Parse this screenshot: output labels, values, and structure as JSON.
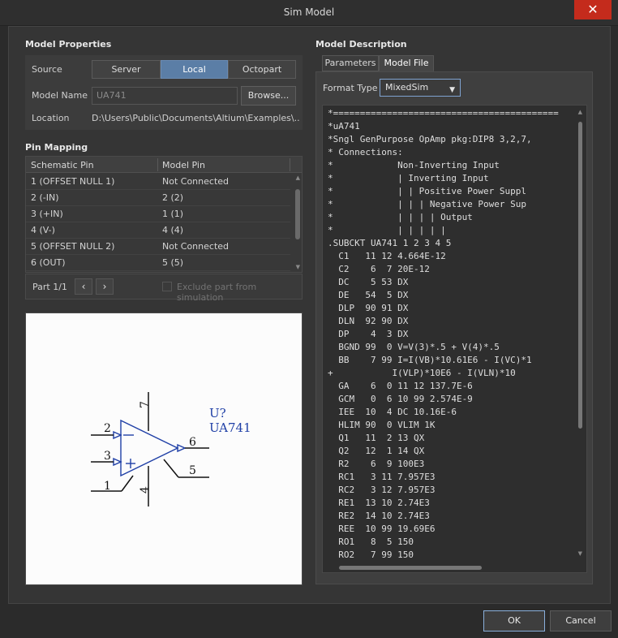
{
  "window": {
    "title": "Sim Model",
    "close_glyph": "✕"
  },
  "model_properties": {
    "title": "Model Properties",
    "source_label": "Source",
    "source_options": [
      "Server",
      "Local",
      "Octopart"
    ],
    "source_selected": "Local",
    "model_name_label": "Model Name",
    "model_name_value": "UA741",
    "browse_label": "Browse...",
    "location_label": "Location",
    "location_value": "D:\\Users\\Public\\Documents\\Altium\\Examples\\..."
  },
  "pin_mapping": {
    "title": "Pin Mapping",
    "columns": [
      "Schematic Pin",
      "Model Pin"
    ],
    "rows": [
      [
        "1 (OFFSET NULL 1)",
        "Not Connected"
      ],
      [
        "2 (-IN)",
        "2 (2)"
      ],
      [
        "3 (+IN)",
        "1 (1)"
      ],
      [
        "4 (V-)",
        "4 (4)"
      ],
      [
        "5 (OFFSET NULL 2)",
        "Not Connected"
      ],
      [
        "6 (OUT)",
        "5 (5)"
      ]
    ],
    "part_label": "Part 1/1",
    "prev_glyph": "‹",
    "next_glyph": "›",
    "exclude_label": "Exclude part from simulation",
    "exclude_checked": false
  },
  "symbol": {
    "designator": "U?",
    "comment": "UA741",
    "pins": [
      "1",
      "2",
      "3",
      "4",
      "5",
      "6",
      "7"
    ],
    "minus_sign": "−",
    "plus_sign": "+"
  },
  "model_description": {
    "title": "Model Description",
    "tabs": [
      "Parameters",
      "Model File"
    ],
    "active_tab": "Model File",
    "format_type_label": "Format Type",
    "format_type_value": "MixedSim",
    "dropdown_glyph": "▼",
    "model_file_lines": [
      "*==========================================",
      "*uA741",
      "*Sngl GenPurpose OpAmp pkg:DIP8 3,2,7,",
      "* Connections:",
      "*            Non-Inverting Input",
      "*            | Inverting Input",
      "*            | | Positive Power Suppl",
      "*            | | | Negative Power Sup",
      "*            | | | | Output",
      "*            | | | | |",
      ".SUBCKT UA741 1 2 3 4 5",
      "  C1   11 12 4.664E-12",
      "  C2    6  7 20E-12",
      "  DC    5 53 DX",
      "  DE   54  5 DX",
      "  DLP  90 91 DX",
      "  DLN  92 90 DX",
      "  DP    4  3 DX",
      "  BGND 99  0 V=V(3)*.5 + V(4)*.5",
      "  BB    7 99 I=I(VB)*10.61E6 - I(VC)*1",
      "+           I(VLP)*10E6 - I(VLN)*10",
      "  GA    6  0 11 12 137.7E-6",
      "  GCM   0  6 10 99 2.574E-9",
      "  IEE  10  4 DC 10.16E-6",
      "  HLIM 90  0 VLIM 1K",
      "  Q1   11  2 13 QX",
      "  Q2   12  1 14 QX",
      "  R2    6  9 100E3",
      "  RC1   3 11 7.957E3",
      "  RC2   3 12 7.957E3",
      "  RE1  13 10 2.74E3",
      "  RE2  14 10 2.74E3",
      "  REE  10 99 19.69E6",
      "  RO1   8  5 150",
      "  RO2   7 99 150"
    ]
  },
  "footer": {
    "ok_label": "OK",
    "cancel_label": "Cancel"
  },
  "colors": {
    "accent": "#5b7ea6",
    "symbol_blue": "#1f3fa6",
    "close_red": "#c42b1c"
  }
}
